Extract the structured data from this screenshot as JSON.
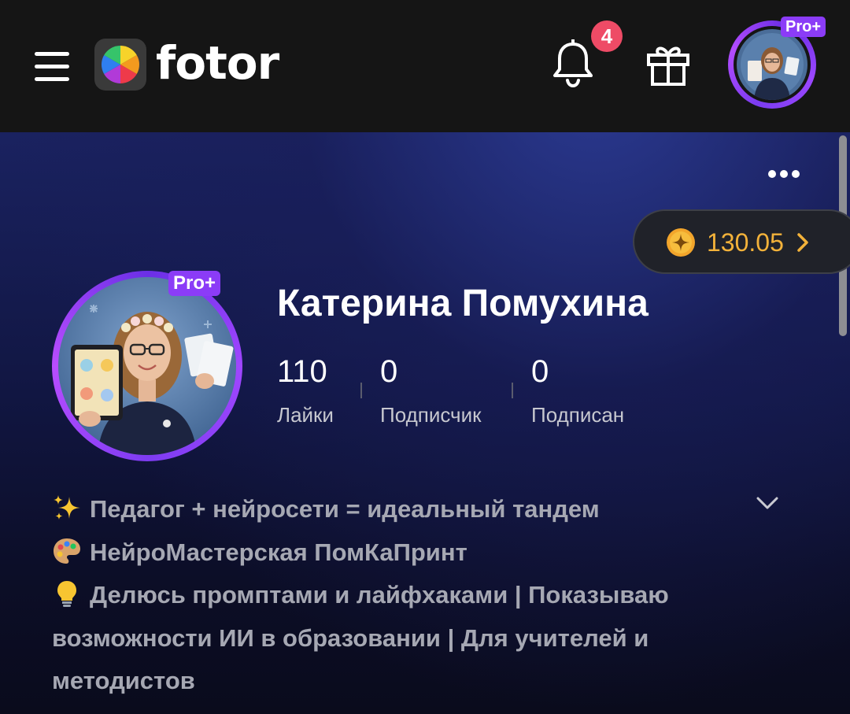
{
  "header": {
    "logo_text": "fotor",
    "notification_count": "4",
    "top_pro_badge": "Pro+"
  },
  "profile": {
    "pro_badge": "Pro+",
    "coins": "130.05",
    "name": "Катерина Помухина",
    "stats": [
      {
        "value": "110",
        "label": "Лайки"
      },
      {
        "value": "0",
        "label": "Подписчик"
      },
      {
        "value": "0",
        "label": "Подписан"
      }
    ],
    "bio": [
      "Педагог + нейросети = идеальный тандем",
      "НейроМастерская ПомКаПринт",
      "Делюсь промптами и лайфхаками | Показываю возможности ИИ в образовании | Для учителей и методистов"
    ]
  },
  "colors": {
    "accent_purple": "#8b3cf7",
    "coin_gold": "#f3b23a",
    "badge_red": "#ee4b66",
    "topbar_bg": "#151515",
    "hero_top": "#1a2260"
  },
  "icons": [
    "menu-icon",
    "bell-icon",
    "gift-icon",
    "more-icon",
    "coin-icon",
    "chevron-right-icon",
    "chevron-down-icon",
    "sparkles-icon",
    "palette-icon",
    "lightbulb-icon"
  ]
}
